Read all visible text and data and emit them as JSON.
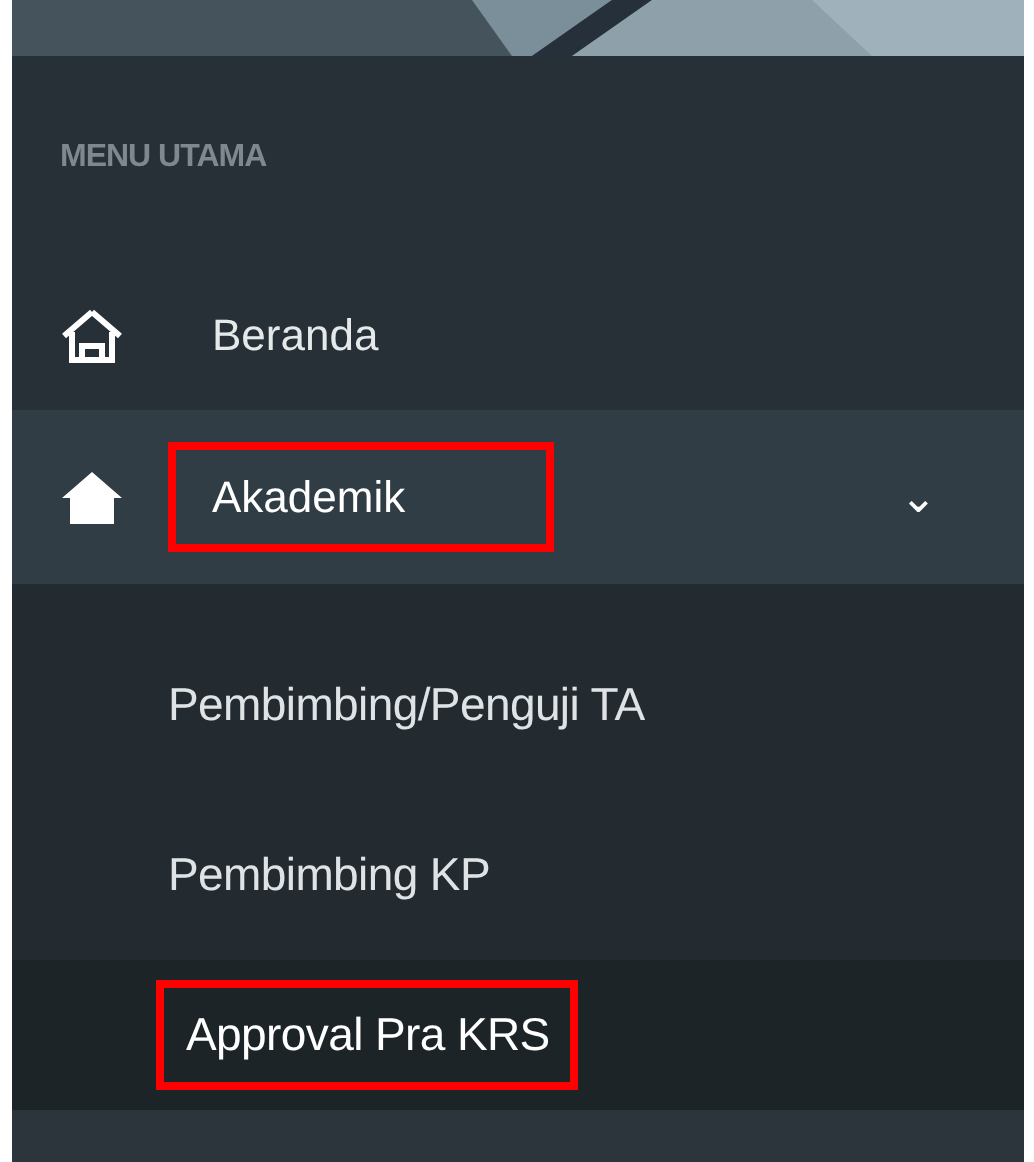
{
  "sidebar": {
    "section_label": "MENU UTAMA",
    "items": [
      {
        "label": "Beranda",
        "active": false,
        "annotated": false
      },
      {
        "label": "Akademik",
        "active": true,
        "annotated": true,
        "expanded": true,
        "chevron": "⌄",
        "children": [
          {
            "label": "Pembimbing/Penguji TA",
            "selected": false,
            "annotated": false
          },
          {
            "label": "Pembimbing KP",
            "selected": false,
            "annotated": false
          },
          {
            "label": "Approval Pra KRS",
            "selected": true,
            "annotated": true
          }
        ]
      }
    ]
  }
}
